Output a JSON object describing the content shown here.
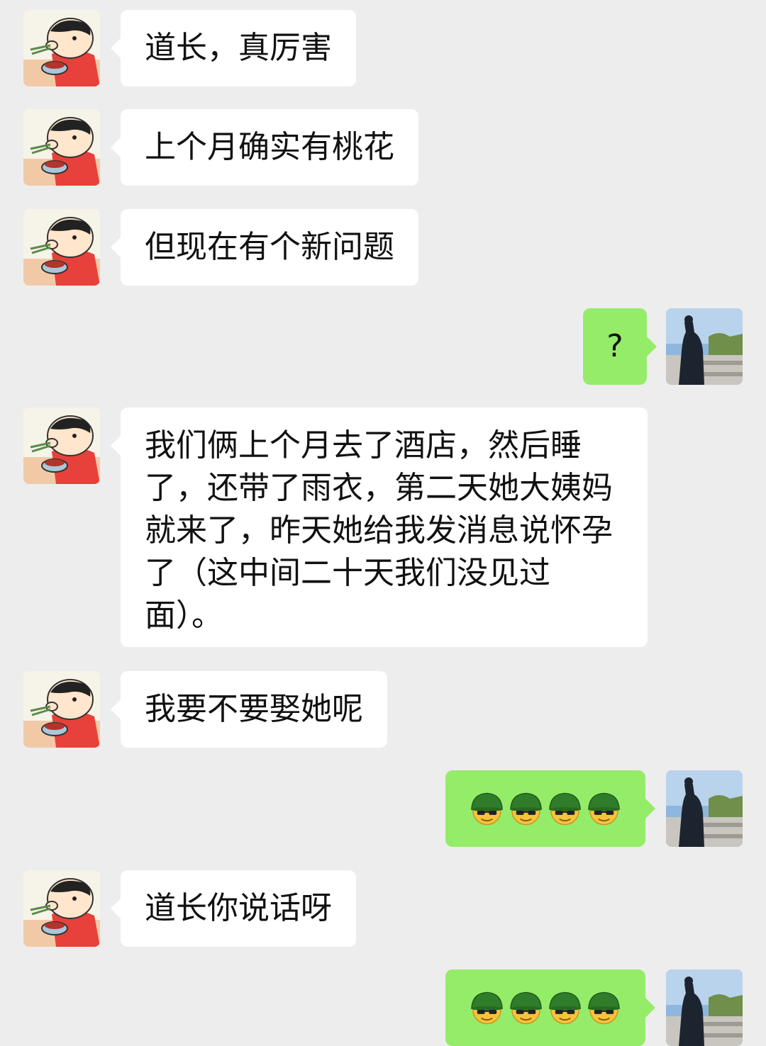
{
  "colors": {
    "background": "#ededed",
    "incoming_bubble": "#ffffff",
    "outgoing_bubble": "#95ec69"
  },
  "messages": [
    {
      "side": "in",
      "text": "道长，真厉害"
    },
    {
      "side": "in",
      "text": "上个月确实有桃花"
    },
    {
      "side": "in",
      "text": "但现在有个新问题"
    },
    {
      "side": "out",
      "text": "?"
    },
    {
      "side": "in",
      "lines": [
        "我们俩上个月去了酒店，然后睡",
        "了，还带了雨衣，第二天她大姨妈",
        "就来了，昨天她给我发消息说怀孕",
        "了（这中间二十天我们没见过",
        "面）。"
      ]
    },
    {
      "side": "in",
      "text": "我要不要娶她呢"
    },
    {
      "side": "out",
      "emoji": "green-helmet-sunglasses-emoji",
      "count": 4
    },
    {
      "side": "in",
      "text": "道长你说话呀"
    },
    {
      "side": "out",
      "emoji": "green-helmet-sunglasses-emoji",
      "count": 4
    }
  ]
}
